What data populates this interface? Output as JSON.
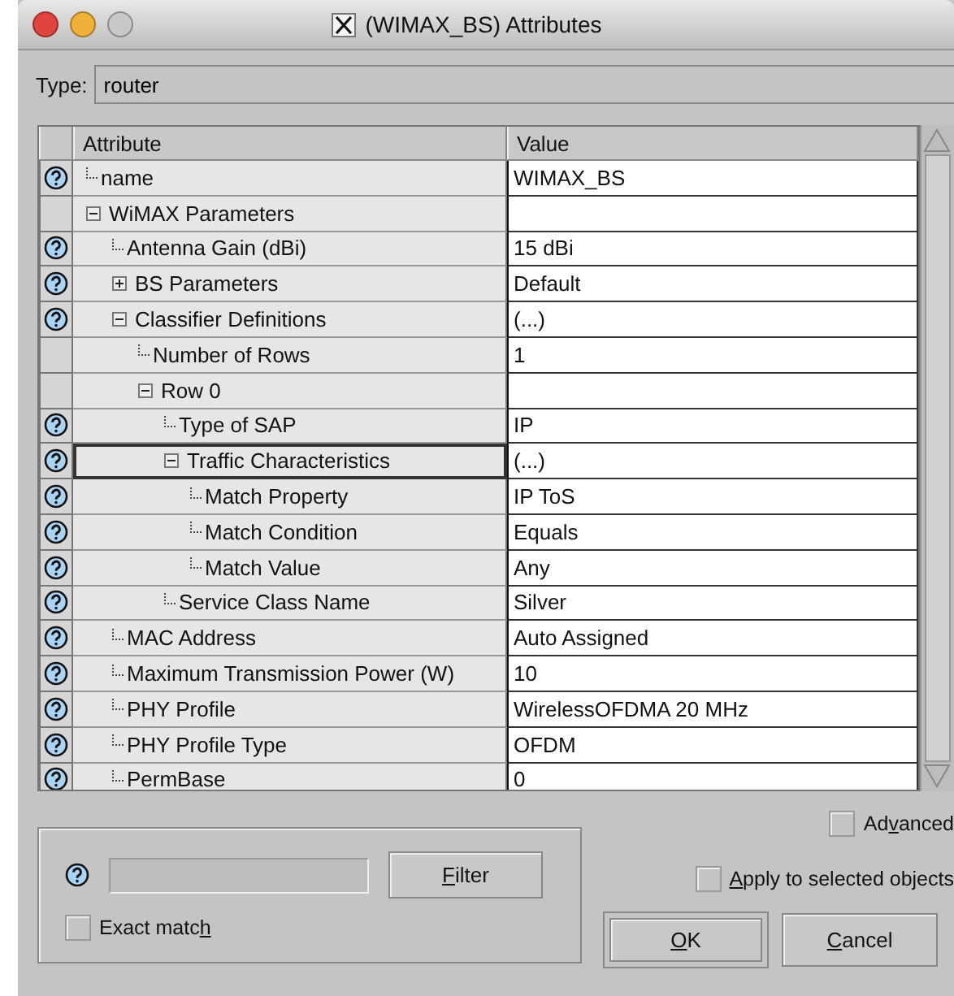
{
  "window": {
    "title": "(WIMAX_BS) Attributes"
  },
  "type_field": {
    "label": "Type:",
    "value": "router"
  },
  "table": {
    "columns": [
      "Attribute",
      "Value"
    ],
    "rows": [
      {
        "attribute": "name",
        "value": "WIMAX_BS",
        "help": true,
        "selected": false
      },
      {
        "attribute": "WiMAX Parameters",
        "help": false,
        "selected": false,
        "expanded": true,
        "children": [
          {
            "attribute": "Antenna Gain (dBi)",
            "value": "15 dBi",
            "help": true,
            "selected": false
          },
          {
            "attribute": "BS Parameters",
            "value": "Default",
            "help": true,
            "selected": false,
            "expanded": false
          },
          {
            "attribute": "Classifier Definitions",
            "value": "(...)",
            "help": true,
            "selected": false,
            "expanded": true,
            "children": [
              {
                "attribute": "Number of Rows",
                "value": "1",
                "help": false,
                "selected": false
              },
              {
                "attribute": "Row 0",
                "help": false,
                "selected": false,
                "expanded": true,
                "children": [
                  {
                    "attribute": "Type of SAP",
                    "value": "IP",
                    "help": true,
                    "selected": false
                  },
                  {
                    "attribute": "Traffic Characteristics",
                    "value": "(...)",
                    "help": true,
                    "selected": true,
                    "expanded": true,
                    "children": [
                      {
                        "attribute": "Match Property",
                        "value": "IP ToS",
                        "help": true,
                        "selected": false
                      },
                      {
                        "attribute": "Match Condition",
                        "value": "Equals",
                        "help": true,
                        "selected": false
                      },
                      {
                        "attribute": "Match Value",
                        "value": "Any",
                        "help": true,
                        "selected": false
                      }
                    ]
                  },
                  {
                    "attribute": "Service Class Name",
                    "value": "Silver",
                    "help": true,
                    "selected": false
                  }
                ]
              }
            ]
          },
          {
            "attribute": "MAC Address",
            "value": "Auto Assigned",
            "help": true,
            "selected": false
          },
          {
            "attribute": "Maximum Transmission Power (W)",
            "value": "10",
            "help": true,
            "selected": false
          },
          {
            "attribute": "PHY Profile",
            "value": "WirelessOFDMA 20 MHz",
            "help": true,
            "selected": false
          },
          {
            "attribute": "PHY Profile Type",
            "value": "OFDM",
            "help": true,
            "selected": false
          },
          {
            "attribute": "PermBase",
            "value": "0",
            "help": true,
            "selected": false
          }
        ]
      }
    ]
  },
  "filter": {
    "button": {
      "key": "F",
      "after": "ilter"
    },
    "exact_match": {
      "before": "Exact matc",
      "key": "h",
      "checked": false
    }
  },
  "advanced": {
    "before": "Ad",
    "key": "v",
    "after": "anced",
    "checked": false
  },
  "apply_to_selected": {
    "key": "A",
    "after": "pply to selected objects",
    "checked": false
  },
  "buttons": [
    {
      "key": "O",
      "after": "K",
      "default": true
    },
    {
      "key": "C",
      "after": "ancel",
      "default": false
    }
  ]
}
